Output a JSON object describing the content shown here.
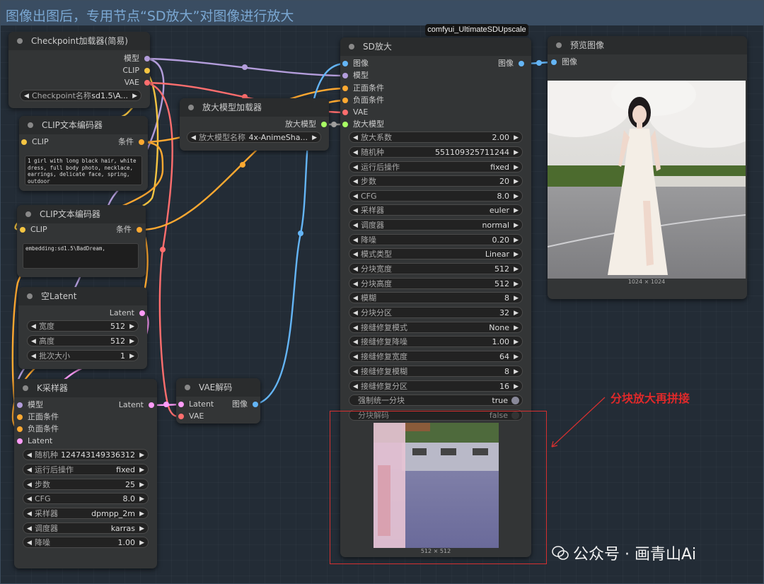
{
  "header": {
    "title": "图像出图后，专用节点“SD放大”对图像进行放大"
  },
  "badge": {
    "label": "comfyui_UltimateSDUpscale"
  },
  "colors": {
    "model": "#b39ddb",
    "clip": "#f5c542",
    "vae": "#ff6e6e",
    "conditioning": "#ffa931",
    "latent": "#ff9cf9",
    "image": "#64b5f6",
    "upscale_model": "#a8ff64",
    "annotation": "#e0292a"
  },
  "checkpoint": {
    "title": "Checkpoint加载器(简易)",
    "outputs": [
      "模型",
      "CLIP",
      "VAE"
    ],
    "widget": {
      "label": "Checkpoint名称",
      "value": "sd1.5\\A..."
    }
  },
  "clip_pos": {
    "title": "CLIP文本编码器",
    "input": "CLIP",
    "output": "条件",
    "text": "1 girl with long black hair, white dress, full body photo, necklace, earrings, delicate face, spring, outdoor"
  },
  "clip_neg": {
    "title": "CLIP文本编码器",
    "input": "CLIP",
    "output": "条件",
    "text": "embedding:sd1.5\\BadDream,"
  },
  "upscale_loader": {
    "title": "放大模型加载器",
    "output": "放大模型",
    "widget": {
      "label": "放大模型名称",
      "value": "4x-AnimeSha..."
    }
  },
  "empty_latent": {
    "title": "空Latent",
    "output": "Latent",
    "widgets": [
      {
        "label": "宽度",
        "value": "512"
      },
      {
        "label": "高度",
        "value": "512"
      },
      {
        "label": "批次大小",
        "value": "1"
      }
    ]
  },
  "ksampler": {
    "title": "K采样器",
    "inputs": [
      "模型",
      "正面条件",
      "负面条件",
      "Latent"
    ],
    "output": "Latent",
    "widgets": [
      {
        "label": "随机种",
        "value": "124743149336312"
      },
      {
        "label": "运行后操作",
        "value": "fixed"
      },
      {
        "label": "步数",
        "value": "25"
      },
      {
        "label": "CFG",
        "value": "8.0"
      },
      {
        "label": "采样器",
        "value": "dpmpp_2m"
      },
      {
        "label": "调度器",
        "value": "karras"
      },
      {
        "label": "降噪",
        "value": "1.00"
      }
    ]
  },
  "vae_decode": {
    "title": "VAE解码",
    "inputs": [
      "Latent",
      "VAE"
    ],
    "output": "图像"
  },
  "sd_upscale": {
    "title": "SD放大",
    "inputs": [
      "图像",
      "模型",
      "正面条件",
      "负面条件",
      "VAE",
      "放大模型"
    ],
    "output": "图像",
    "widgets": [
      {
        "label": "放大系数",
        "value": "2.00"
      },
      {
        "label": "随机种",
        "value": "551109325711244"
      },
      {
        "label": "运行后操作",
        "value": "fixed"
      },
      {
        "label": "步数",
        "value": "20"
      },
      {
        "label": "CFG",
        "value": "8.0"
      },
      {
        "label": "采样器",
        "value": "euler"
      },
      {
        "label": "调度器",
        "value": "normal"
      },
      {
        "label": "降噪",
        "value": "0.20"
      },
      {
        "label": "模式类型",
        "value": "Linear"
      },
      {
        "label": "分块宽度",
        "value": "512"
      },
      {
        "label": "分块高度",
        "value": "512"
      },
      {
        "label": "模糊",
        "value": "8"
      },
      {
        "label": "分块分区",
        "value": "32"
      },
      {
        "label": "接缝修复模式",
        "value": "None"
      },
      {
        "label": "接缝修复降噪",
        "value": "1.00"
      },
      {
        "label": "接缝修复宽度",
        "value": "64"
      },
      {
        "label": "接缝修复模糊",
        "value": "8"
      },
      {
        "label": "接缝修复分区",
        "value": "16"
      }
    ],
    "toggles": [
      {
        "label": "强制统一分块",
        "value": "true"
      },
      {
        "label": "分块解码",
        "value": "false"
      }
    ],
    "preview_size": "512 × 512"
  },
  "preview": {
    "title": "预览图像",
    "input": "图像",
    "image_size": "1024 × 1024"
  },
  "annotation": {
    "text": "分块放大再拼接"
  },
  "watermark": {
    "text": "公众号 · 画青山Ai"
  }
}
